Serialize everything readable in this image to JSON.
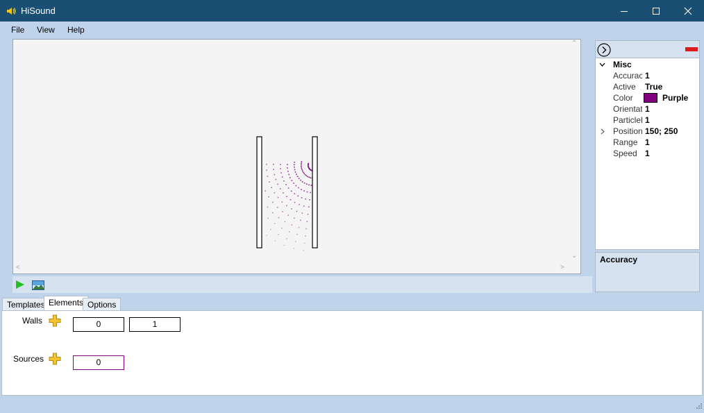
{
  "window": {
    "title": "HiSound",
    "minimize_icon": "minimize-icon",
    "maximize_icon": "maximize-icon",
    "close_icon": "close-icon"
  },
  "menu": [
    {
      "label": "File"
    },
    {
      "label": "View"
    },
    {
      "label": "Help"
    }
  ],
  "simulation": {
    "walls": 2,
    "source_color": "#800080",
    "wave_fronts": 12
  },
  "toolbar": {
    "play_icon": "play-icon",
    "image_icon": "image-icon"
  },
  "properties": {
    "category": "Misc",
    "rows": [
      {
        "name": "Accurac",
        "value": "1"
      },
      {
        "name": "Active",
        "value": "True"
      },
      {
        "name": "Color",
        "value": "Purple",
        "swatch": "#800080"
      },
      {
        "name": "Orientatio",
        "value": "1"
      },
      {
        "name": "ParticleL",
        "value": "1"
      },
      {
        "name": "Position_",
        "value": "150; 250",
        "expandable": true
      },
      {
        "name": "Range",
        "value": "1"
      },
      {
        "name": "Speed",
        "value": "1"
      }
    ],
    "description_title": "Accuracy"
  },
  "tabs": [
    {
      "label": "Templates"
    },
    {
      "label": "Elements",
      "active": true
    },
    {
      "label": "Options"
    }
  ],
  "elements": {
    "walls_label": "Walls",
    "walls": [
      "0",
      "1"
    ],
    "sources_label": "Sources",
    "sources": [
      "0"
    ],
    "source_border_color": "#800080"
  }
}
